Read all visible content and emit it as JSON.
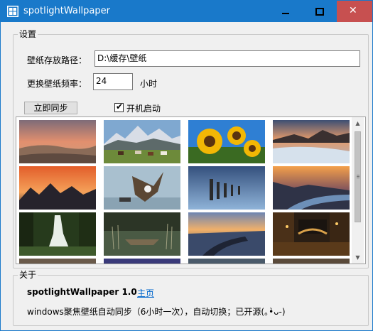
{
  "window": {
    "title": "spotlightWallpaper",
    "minimize_glyph": "minimize-icon",
    "maximize_glyph": "maximize-icon",
    "close_symbol": "✕",
    "titlebar_color": "#1979ca",
    "close_hover_color": "#c75050"
  },
  "settings": {
    "group_label": "设置",
    "path_label": "壁纸存放路径：",
    "path_value": "D:\\缓存\\壁纸",
    "freq_label": "更换壁纸频率：",
    "freq_value": "24",
    "freq_unit": "小时",
    "sync_button": "立即同步",
    "autostart_label": "开机启动",
    "autostart_checked": true,
    "check_symbol": "✔"
  },
  "gallery": {
    "thumbnails": [
      {
        "name": "desert-sunset-dunes"
      },
      {
        "name": "mountain-horses-meadow"
      },
      {
        "name": "sunflowers-blue-sky"
      },
      {
        "name": "frozen-shore-dusk"
      },
      {
        "name": "mountain-peaks-orange-sky"
      },
      {
        "name": "eagle-over-beach"
      },
      {
        "name": "pier-posts-blue-water"
      },
      {
        "name": "river-valley-sunset"
      },
      {
        "name": "forest-waterfall"
      },
      {
        "name": "rowboat-lake-reeds"
      },
      {
        "name": "rocky-coast-sunset"
      },
      {
        "name": "venice-canal-night"
      }
    ],
    "scroll": {
      "up": "▲",
      "down": "▼"
    }
  },
  "about": {
    "group_label": "关于",
    "app_name": "spotlightWallpaper 1.0",
    "home_link": "主页",
    "description": "windows聚焦壁纸自动同步（6小时一次），自动切换；已开源(｡•̀ᴗ-)"
  }
}
